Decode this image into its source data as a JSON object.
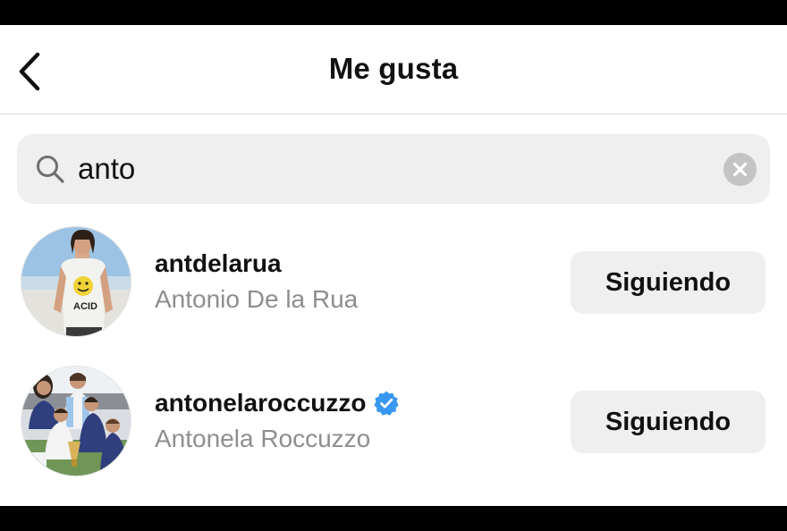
{
  "header": {
    "title": "Me gusta",
    "back_icon": "chevron-left-icon"
  },
  "search": {
    "value": "anto",
    "search_icon": "search-icon",
    "clear_icon": "clear-icon"
  },
  "results": [
    {
      "username": "antdelarua",
      "full_name": "Antonio De la Rua",
      "verified": false,
      "button_label": "Siguiendo"
    },
    {
      "username": "antonelaroccuzzo",
      "full_name": "Antonela Roccuzzo",
      "verified": true,
      "button_label": "Siguiendo"
    }
  ],
  "colors": {
    "verified_badge": "#3897f0",
    "secondary_text": "#8e8e8e",
    "button_bg": "#efefef"
  }
}
